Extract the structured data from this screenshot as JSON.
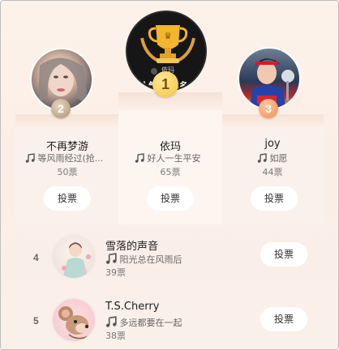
{
  "colors": {
    "accent_gold": "#f3c43a",
    "silver": "#b9aa97",
    "bronze": "#ee9a5c",
    "background": "#fbeee6"
  },
  "podium": [
    {
      "rank": "2",
      "name": "不再梦游",
      "song": "等风雨经过(抢...",
      "votes": "50票",
      "vote_label": "投票",
      "avatar": "woman-portrait"
    },
    {
      "rank": "1",
      "name": "依玛",
      "song": "好人一生平安",
      "votes": "65票",
      "vote_label": "投票",
      "avatar": "trophy-badge",
      "avatar_caption": "依玛",
      "avatar_banner": "人气...第1名"
    },
    {
      "rank": "3",
      "name": "joy",
      "song": "如愿",
      "votes": "44票",
      "vote_label": "投票",
      "avatar": "snow-white-costume"
    }
  ],
  "list": [
    {
      "rank": "4",
      "name": "雪落的声音",
      "song": "阳光总在风雨后",
      "votes": "39票",
      "vote_label": "投票",
      "avatar": "illustrated-girl"
    },
    {
      "rank": "5",
      "name": "T.S.Cherry",
      "song": "多远都要在一起",
      "votes": "38票",
      "vote_label": "投票",
      "avatar": "cartoon-mouse"
    }
  ]
}
